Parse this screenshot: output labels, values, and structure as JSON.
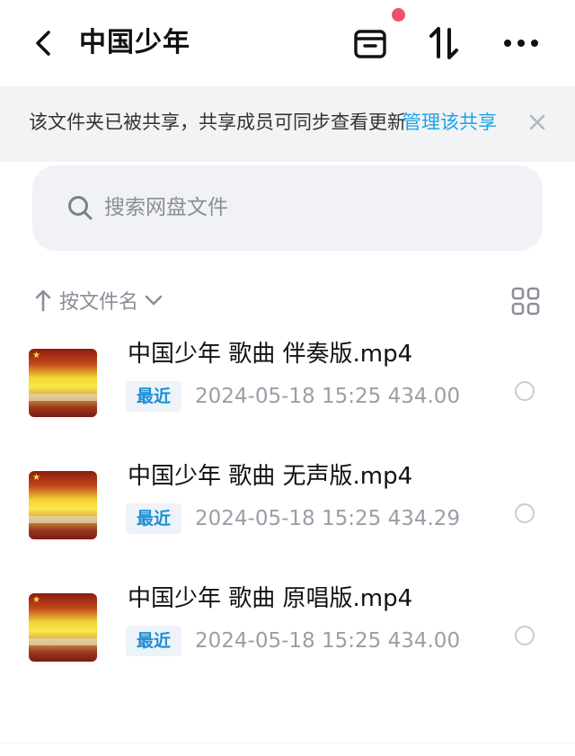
{
  "header": {
    "title": "中国少年",
    "back_icon": "chevron-left-icon",
    "icons": [
      "archive-box-icon",
      "sort-arrows-icon",
      "more-icon"
    ],
    "notification_color": "#f0506e"
  },
  "banner": {
    "text": "该文件夹已被共享，共享成员可同步查看更新",
    "link": "管理该共享",
    "link_color": "#1aa3e8",
    "close_icon": "close-icon"
  },
  "search": {
    "placeholder": "搜索网盘文件",
    "icon": "search-icon"
  },
  "sort": {
    "label": "按文件名",
    "arrow_icon": "arrow-up-icon",
    "dropdown_icon": "chevron-down-icon",
    "view_icon": "grid-view-icon"
  },
  "files": [
    {
      "name": "中国少年 歌曲 伴奏版.mp4",
      "badge": "最近",
      "date": "2024-05-18",
      "time": "15:25",
      "size": "434.00"
    },
    {
      "name": "中国少年 歌曲 无声版.mp4",
      "badge": "最近",
      "date": "2024-05-18",
      "time": "15:25",
      "size": "434.29"
    },
    {
      "name": "中国少年 歌曲 原唱版.mp4",
      "badge": "最近",
      "date": "2024-05-18",
      "time": "15:25",
      "size": "434.00"
    }
  ],
  "colors": {
    "accent": "#1a8fd6",
    "badge_bg": "#eef3f9",
    "search_bg": "#f1f2f6",
    "banner_bg": "#f2f3f5"
  }
}
